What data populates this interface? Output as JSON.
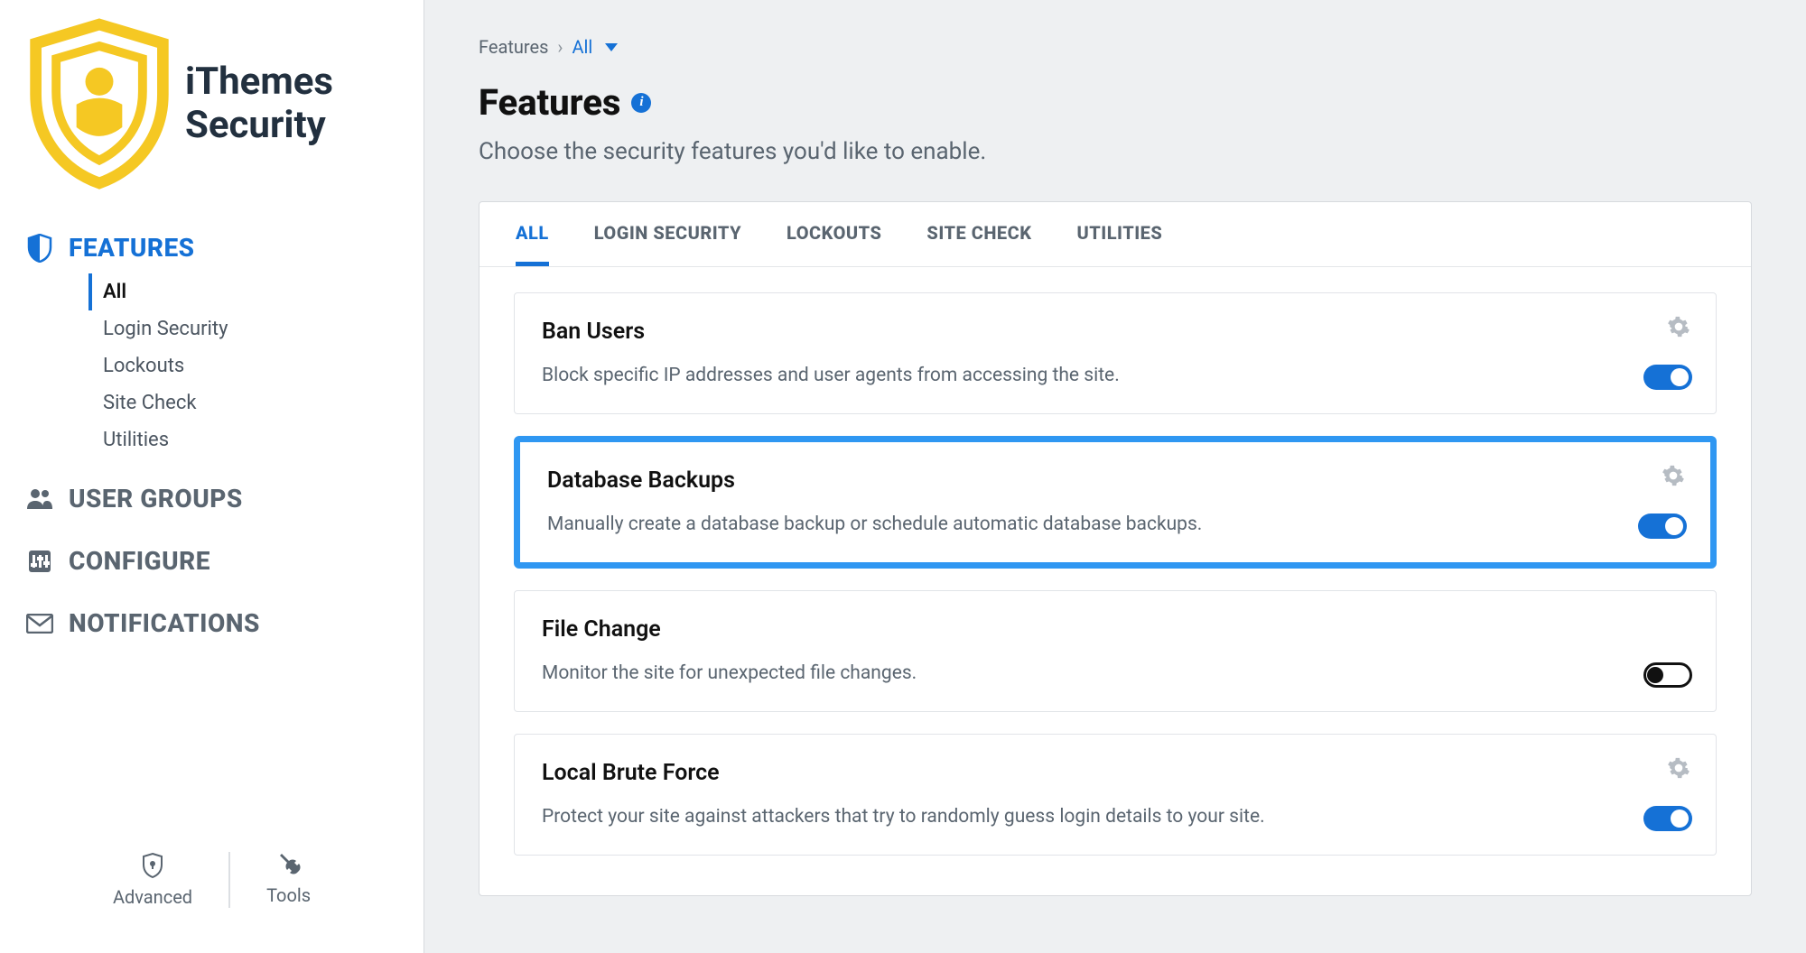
{
  "brand": {
    "line1": "iThemes",
    "line2": "Security"
  },
  "nav": {
    "features": "FEATURES",
    "user_groups": "USER GROUPS",
    "configure": "CONFIGURE",
    "notifications": "NOTIFICATIONS"
  },
  "subnav": {
    "all": "All",
    "login_security": "Login Security",
    "lockouts": "Lockouts",
    "site_check": "Site Check",
    "utilities": "Utilities"
  },
  "tools": {
    "advanced": "Advanced",
    "tools": "Tools"
  },
  "breadcrumb": {
    "root": "Features",
    "current": "All"
  },
  "page": {
    "title": "Features",
    "desc": "Choose the security features you'd like to enable."
  },
  "tabs": {
    "all": "ALL",
    "login_security": "LOGIN SECURITY",
    "lockouts": "LOCKOUTS",
    "site_check": "SITE CHECK",
    "utilities": "UTILITIES"
  },
  "cards": [
    {
      "title": "Ban Users",
      "desc": "Block specific IP addresses and user agents from accessing the site.",
      "enabled": true,
      "has_settings": true,
      "highlight": false
    },
    {
      "title": "Database Backups",
      "desc": "Manually create a database backup or schedule automatic database backups.",
      "enabled": true,
      "has_settings": true,
      "highlight": true
    },
    {
      "title": "File Change",
      "desc": "Monitor the site for unexpected file changes.",
      "enabled": false,
      "has_settings": false,
      "highlight": false
    },
    {
      "title": "Local Brute Force",
      "desc": "Protect your site against attackers that try to randomly guess login details to your site.",
      "enabled": true,
      "has_settings": true,
      "highlight": false
    }
  ]
}
